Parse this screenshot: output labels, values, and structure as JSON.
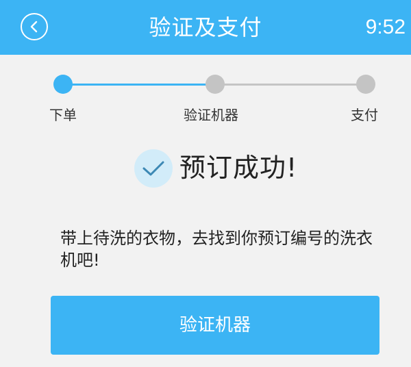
{
  "header": {
    "title": "验证及支付",
    "time": "9:52",
    "back_icon": "chevron-left-circle-icon"
  },
  "stepper": {
    "steps": [
      {
        "label": "下单",
        "status": "active"
      },
      {
        "label": "验证机器",
        "status": "pending"
      },
      {
        "label": "支付",
        "status": "pending"
      }
    ]
  },
  "success": {
    "icon": "check-icon",
    "title": "预订成功!",
    "message": "带上待洗的衣物，去找到你预订编号的洗衣机吧!"
  },
  "actions": {
    "verify_label": "验证机器"
  },
  "colors": {
    "primary": "#3cb4f4",
    "inactive": "#c4c4c4",
    "background": "#f2f2f2",
    "check_bg": "#d2ecf9",
    "check_stroke": "#3c88b4"
  }
}
